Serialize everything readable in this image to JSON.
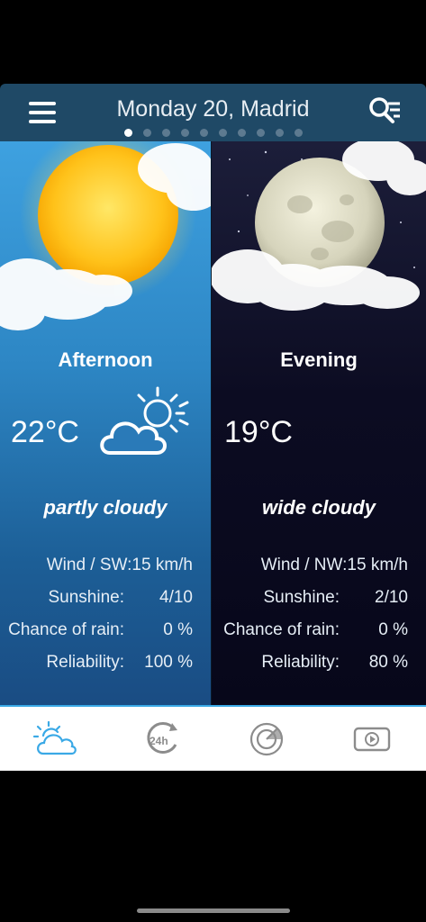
{
  "header": {
    "title": "Monday 20, Madrid",
    "menu_icon": "hamburger-menu-icon",
    "search_icon": "search-list-icon",
    "page_dots": 10,
    "active_dot": 0
  },
  "afternoon": {
    "period": "Afternoon",
    "temperature": "22°C",
    "condition": "partly cloudy",
    "icon": "partly-cloudy-icon",
    "wind": "Wind / SW:15 km/h",
    "sunshine_label": "Sunshine:",
    "sunshine_value": "4/10",
    "rain_label": "Chance of rain:",
    "rain_value": "0 %",
    "reliability_label": "Reliability:",
    "reliability_value": "100 %"
  },
  "evening": {
    "period": "Evening",
    "temperature": "19°C",
    "condition": "wide cloudy",
    "wind": "Wind / NW:15 km/h",
    "sunshine_label": "Sunshine:",
    "sunshine_value": "2/10",
    "rain_label": "Chance of rain:",
    "rain_value": "0 %",
    "reliability_label": "Reliability:",
    "reliability_value": "80 %"
  },
  "tabs": [
    {
      "icon": "weather-icon",
      "active": true
    },
    {
      "icon": "24h-forecast-icon",
      "active": false
    },
    {
      "icon": "radar-icon",
      "active": false
    },
    {
      "icon": "video-icon",
      "active": false
    }
  ],
  "colors": {
    "header_bg": "#1f4966",
    "accent": "#3aa9e6",
    "inactive_icon": "#8c8c8c"
  }
}
